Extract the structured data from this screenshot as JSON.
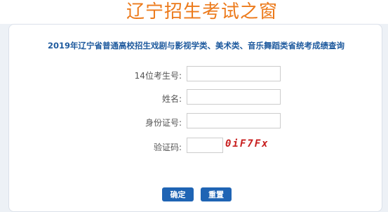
{
  "header": {
    "site_title": "辽宁招生考试之窗"
  },
  "form": {
    "title": "2019年辽宁省普通高校招生戏剧与影视学类、美术类、音乐舞蹈类省统考成绩查询",
    "fields": [
      {
        "label": "14位考生号:",
        "value": ""
      },
      {
        "label": "姓名:",
        "value": ""
      },
      {
        "label": "身份证号:",
        "value": ""
      },
      {
        "label": "验证码:",
        "value": ""
      }
    ],
    "captcha_text": "0iF7Fx",
    "confirm_label": "确定",
    "reset_label": "重置"
  },
  "colors": {
    "title_orange": "#ec7a1b",
    "form_title_blue": "#1e5a9e",
    "button_blue": "#1f64b4",
    "captcha_red": "#c81e1e"
  }
}
